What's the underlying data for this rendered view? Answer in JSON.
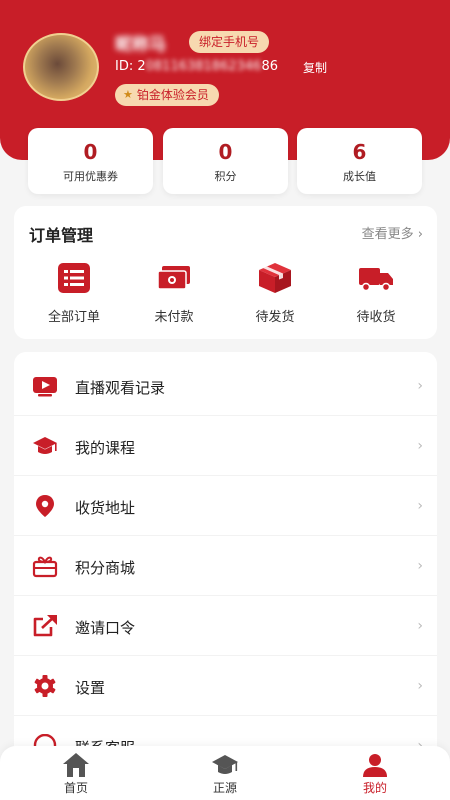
{
  "profile": {
    "username": "昵称马",
    "bind_phone_label": "绑定手机号",
    "id_prefix": "ID: 2",
    "id_masked": "08116381862346",
    "id_suffix": "86",
    "copy_label": "复制",
    "member_label": "铂金体验会员"
  },
  "stats": [
    {
      "value": "0",
      "label": "可用优惠券"
    },
    {
      "value": "0",
      "label": "积分"
    },
    {
      "value": "6",
      "label": "成长值"
    }
  ],
  "orders": {
    "title": "订单管理",
    "more": "查看更多",
    "items": [
      {
        "label": "全部订单",
        "icon": "list-icon"
      },
      {
        "label": "未付款",
        "icon": "cash-icon"
      },
      {
        "label": "待发货",
        "icon": "box-icon"
      },
      {
        "label": "待收货",
        "icon": "truck-icon"
      }
    ]
  },
  "menu": [
    {
      "label": "直播观看记录",
      "icon": "live-play-icon"
    },
    {
      "label": "我的课程",
      "icon": "graduation-cap-icon"
    },
    {
      "label": "收货地址",
      "icon": "location-pin-icon"
    },
    {
      "label": "积分商城",
      "icon": "gift-icon"
    },
    {
      "label": "邀请口令",
      "icon": "share-icon"
    },
    {
      "label": "设置",
      "icon": "gear-icon"
    },
    {
      "label": "联系客服",
      "icon": "headset-icon"
    }
  ],
  "tabbar": [
    {
      "label": "首页",
      "icon": "home-icon"
    },
    {
      "label": "正源",
      "icon": "graduation-cap-icon"
    },
    {
      "label": "我的",
      "icon": "user-icon"
    }
  ],
  "colors": {
    "brand": "#c81e28",
    "badge_bg": "#f7d9b0"
  }
}
